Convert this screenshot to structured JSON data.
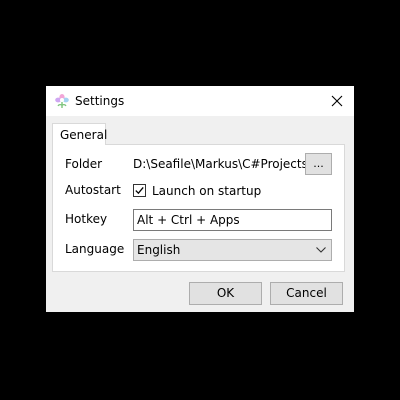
{
  "window": {
    "title": "Settings",
    "app_icon": "seafile-flower-icon",
    "close_icon": "close-icon"
  },
  "tabs": [
    {
      "label": "General",
      "selected": true
    }
  ],
  "general": {
    "folder_label": "Folder",
    "folder_value": "D:\\Seafile\\Markus\\C#Projects",
    "browse_label": "...",
    "autostart_label": "Autostart",
    "launch_on_startup_label": "Launch on startup",
    "launch_on_startup_checked": true,
    "hotkey_label": "Hotkey",
    "hotkey_value": "Alt + Ctrl + Apps",
    "language_label": "Language",
    "language_value": "English",
    "language_icon": "chevron-down-icon"
  },
  "buttons": {
    "ok_label": "OK",
    "cancel_label": "Cancel"
  },
  "colors": {
    "background": "#000000",
    "dialog": "#f0f0f0",
    "panel": "#ffffff",
    "button": "#e1e1e1",
    "border": "#adadad"
  }
}
